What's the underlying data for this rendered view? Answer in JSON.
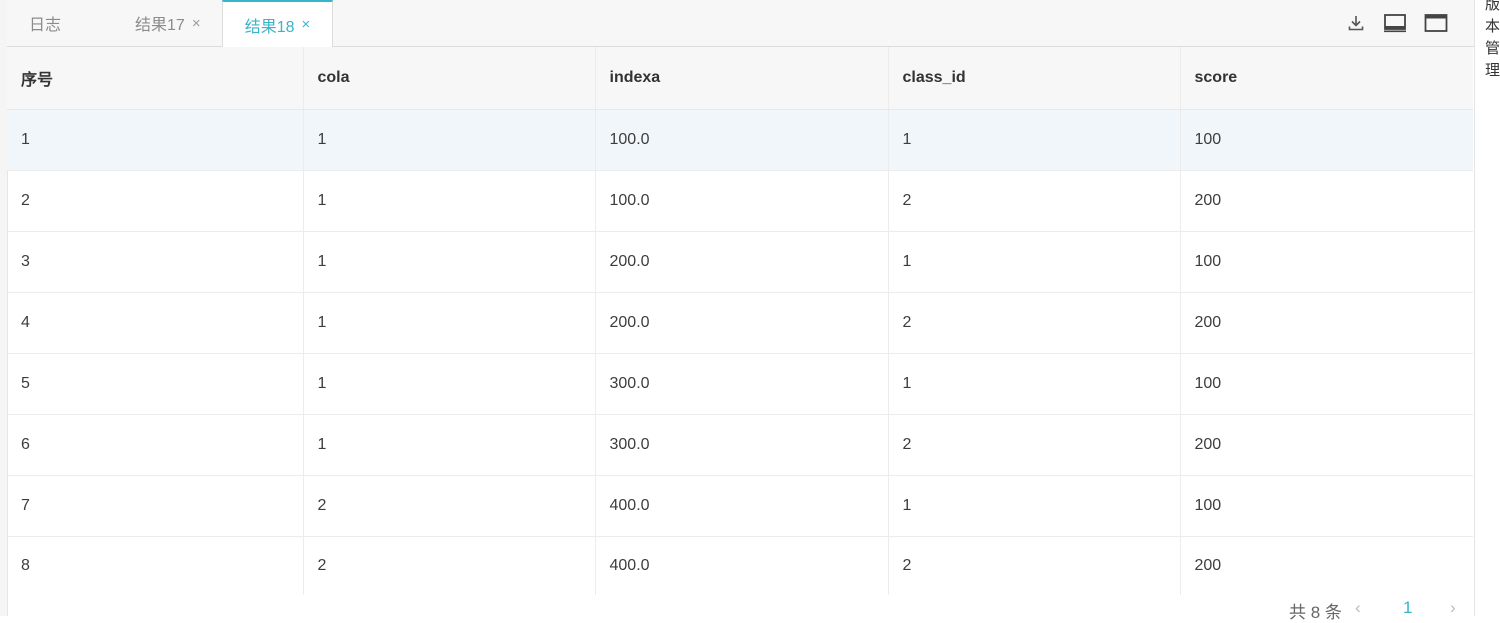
{
  "tabs": {
    "log": "日志",
    "result17": "结果17",
    "result18": "结果18",
    "close_glyph": "×"
  },
  "toolbar": {
    "icons": [
      "download-icon",
      "dock-bottom-icon",
      "maximize-icon"
    ]
  },
  "table": {
    "columns": [
      "序号",
      "cola",
      "indexa",
      "class_id",
      "score"
    ],
    "rows": [
      [
        "1",
        "1",
        "100.0",
        "1",
        "100"
      ],
      [
        "2",
        "1",
        "100.0",
        "2",
        "200"
      ],
      [
        "3",
        "1",
        "200.0",
        "1",
        "100"
      ],
      [
        "4",
        "1",
        "200.0",
        "2",
        "200"
      ],
      [
        "5",
        "1",
        "300.0",
        "1",
        "100"
      ],
      [
        "6",
        "1",
        "300.0",
        "2",
        "200"
      ],
      [
        "7",
        "2",
        "400.0",
        "1",
        "100"
      ],
      [
        "8",
        "2",
        "400.0",
        "2",
        "200"
      ]
    ],
    "highlighted_row": 0
  },
  "pagination": {
    "total": "共 8 条",
    "current_page": "1",
    "prev_glyph": "‹",
    "next_glyph": "›"
  },
  "side_panel": {
    "label": "版本管理"
  },
  "colors": {
    "accent": "#38b5c8",
    "row_highlight": "#f1f6fa",
    "header_bg": "#f7f7f7"
  }
}
